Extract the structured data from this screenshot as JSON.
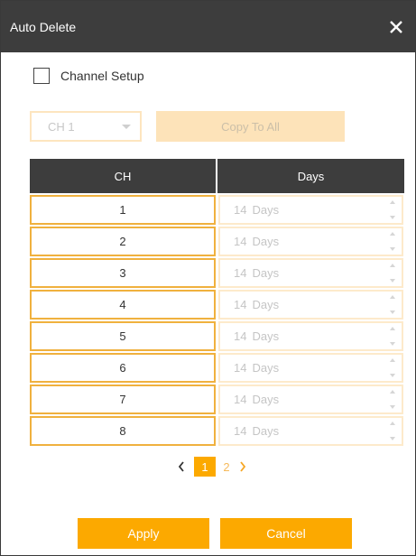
{
  "dialog": {
    "title": "Auto Delete"
  },
  "channel_setup": {
    "label": "Channel Setup",
    "checked": false
  },
  "channel_select": {
    "value": "CH 1"
  },
  "copy_button": {
    "label": "Copy To All"
  },
  "table": {
    "headers": {
      "ch": "CH",
      "days": "Days"
    },
    "rows": [
      {
        "ch": "1",
        "days": "14",
        "unit": "Days"
      },
      {
        "ch": "2",
        "days": "14",
        "unit": "Days"
      },
      {
        "ch": "3",
        "days": "14",
        "unit": "Days"
      },
      {
        "ch": "4",
        "days": "14",
        "unit": "Days"
      },
      {
        "ch": "5",
        "days": "14",
        "unit": "Days"
      },
      {
        "ch": "6",
        "days": "14",
        "unit": "Days"
      },
      {
        "ch": "7",
        "days": "14",
        "unit": "Days"
      },
      {
        "ch": "8",
        "days": "14",
        "unit": "Days"
      }
    ]
  },
  "pagination": {
    "pages": [
      "1",
      "2"
    ],
    "current": "1"
  },
  "buttons": {
    "apply": "Apply",
    "cancel": "Cancel"
  },
  "icons": {
    "close": "close-icon",
    "prev": "chevron-left-icon",
    "next": "chevron-right-icon",
    "dropdown": "caret-down-icon"
  },
  "colors": {
    "accent": "#fca900",
    "header": "#3d3d3d",
    "cell_border": "#f0b13e"
  }
}
